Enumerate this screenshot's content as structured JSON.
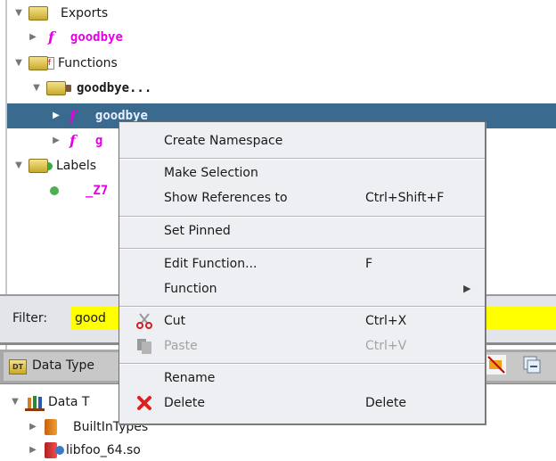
{
  "symbol_tree": {
    "rows": [
      {
        "label": "Exports",
        "kind": "folder",
        "expanded": true
      },
      {
        "label": "goodbye",
        "kind": "function-export"
      },
      {
        "label": "Functions",
        "kind": "folder-functions",
        "expanded": true
      },
      {
        "label": "goodbye...",
        "kind": "namespace",
        "expanded": true
      },
      {
        "label": "goodbye",
        "kind": "function-thunk",
        "selected": true
      },
      {
        "label": "g",
        "kind": "function"
      },
      {
        "label": "Labels",
        "kind": "folder-labels",
        "expanded": true
      },
      {
        "label": "_Z7",
        "kind": "label"
      }
    ],
    "icons": {
      "function": "f"
    }
  },
  "filter": {
    "label": "Filter:",
    "value": "good"
  },
  "data_type_manager": {
    "title": "Data Type",
    "tab_icon_text": "DT",
    "tree": [
      {
        "label": "Data T",
        "kind": "archive-root",
        "expanded": true
      },
      {
        "label": "BuiltInTypes",
        "kind": "builtin"
      },
      {
        "label": "libfoo_64.so",
        "kind": "program-archive"
      }
    ]
  },
  "context_menu": {
    "items": [
      {
        "label": "Create Namespace",
        "accelerator": "",
        "icon": ""
      },
      {
        "label": "Make Selection",
        "accelerator": "",
        "icon": ""
      },
      {
        "label": "Show References to",
        "accelerator": "Ctrl+Shift+F",
        "icon": ""
      },
      {
        "label": "Set Pinned",
        "accelerator": "",
        "icon": ""
      },
      {
        "label": "Edit Function...",
        "accelerator": "F",
        "icon": ""
      },
      {
        "label": "Function",
        "accelerator": "",
        "icon": "",
        "submenu": "▶"
      },
      {
        "label": "Cut",
        "accelerator": "Ctrl+X",
        "icon": "scissors-icon"
      },
      {
        "label": "Paste",
        "accelerator": "Ctrl+V",
        "icon": "paste-icon",
        "disabled": true
      },
      {
        "label": "Rename",
        "accelerator": "",
        "icon": ""
      },
      {
        "label": "Delete",
        "accelerator": "Delete",
        "icon": "delete-x-icon"
      }
    ]
  },
  "colors": {
    "selection": "#3b6a8f",
    "symbol_magenta": "#e600e6",
    "filter_highlight": "#ffff00",
    "menu_bg": "#eeeff3"
  }
}
